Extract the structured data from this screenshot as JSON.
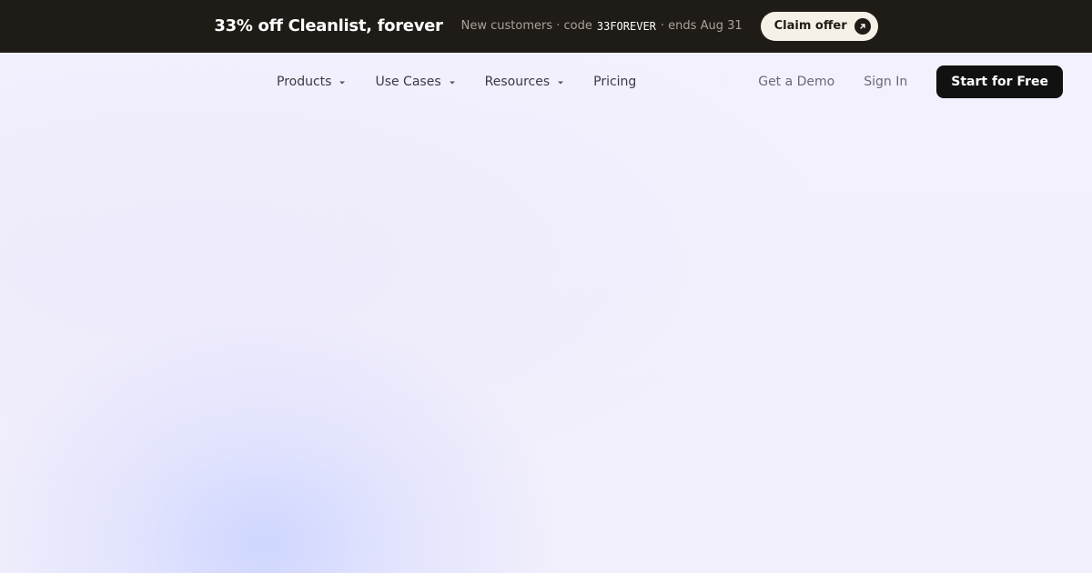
{
  "banner": {
    "title": "33% off Cleanlist, forever",
    "sub_prefix": "New customers · code",
    "code": "33FOREVER",
    "sub_suffix": "· ends Aug 31",
    "claim_label": "Claim offer"
  },
  "nav": {
    "items": [
      {
        "label": "Products"
      },
      {
        "label": "Use Cases"
      },
      {
        "label": "Resources"
      },
      {
        "label": "Pricing"
      }
    ],
    "demo_label": "Get a Demo",
    "signin_label": "Sign In",
    "start_label": "Start for Free"
  },
  "icons": {
    "theme": "moon-icon",
    "claim": "arrow-up-right-icon",
    "dropdown": "chevron-down-icon"
  },
  "colors": {
    "banner_bg": "#1f1b16",
    "claim_bg": "#f6f1e7",
    "primary_button": "#111111",
    "hero_bg": "#f3f1fc",
    "hero_glow": "#cdd5ff"
  }
}
